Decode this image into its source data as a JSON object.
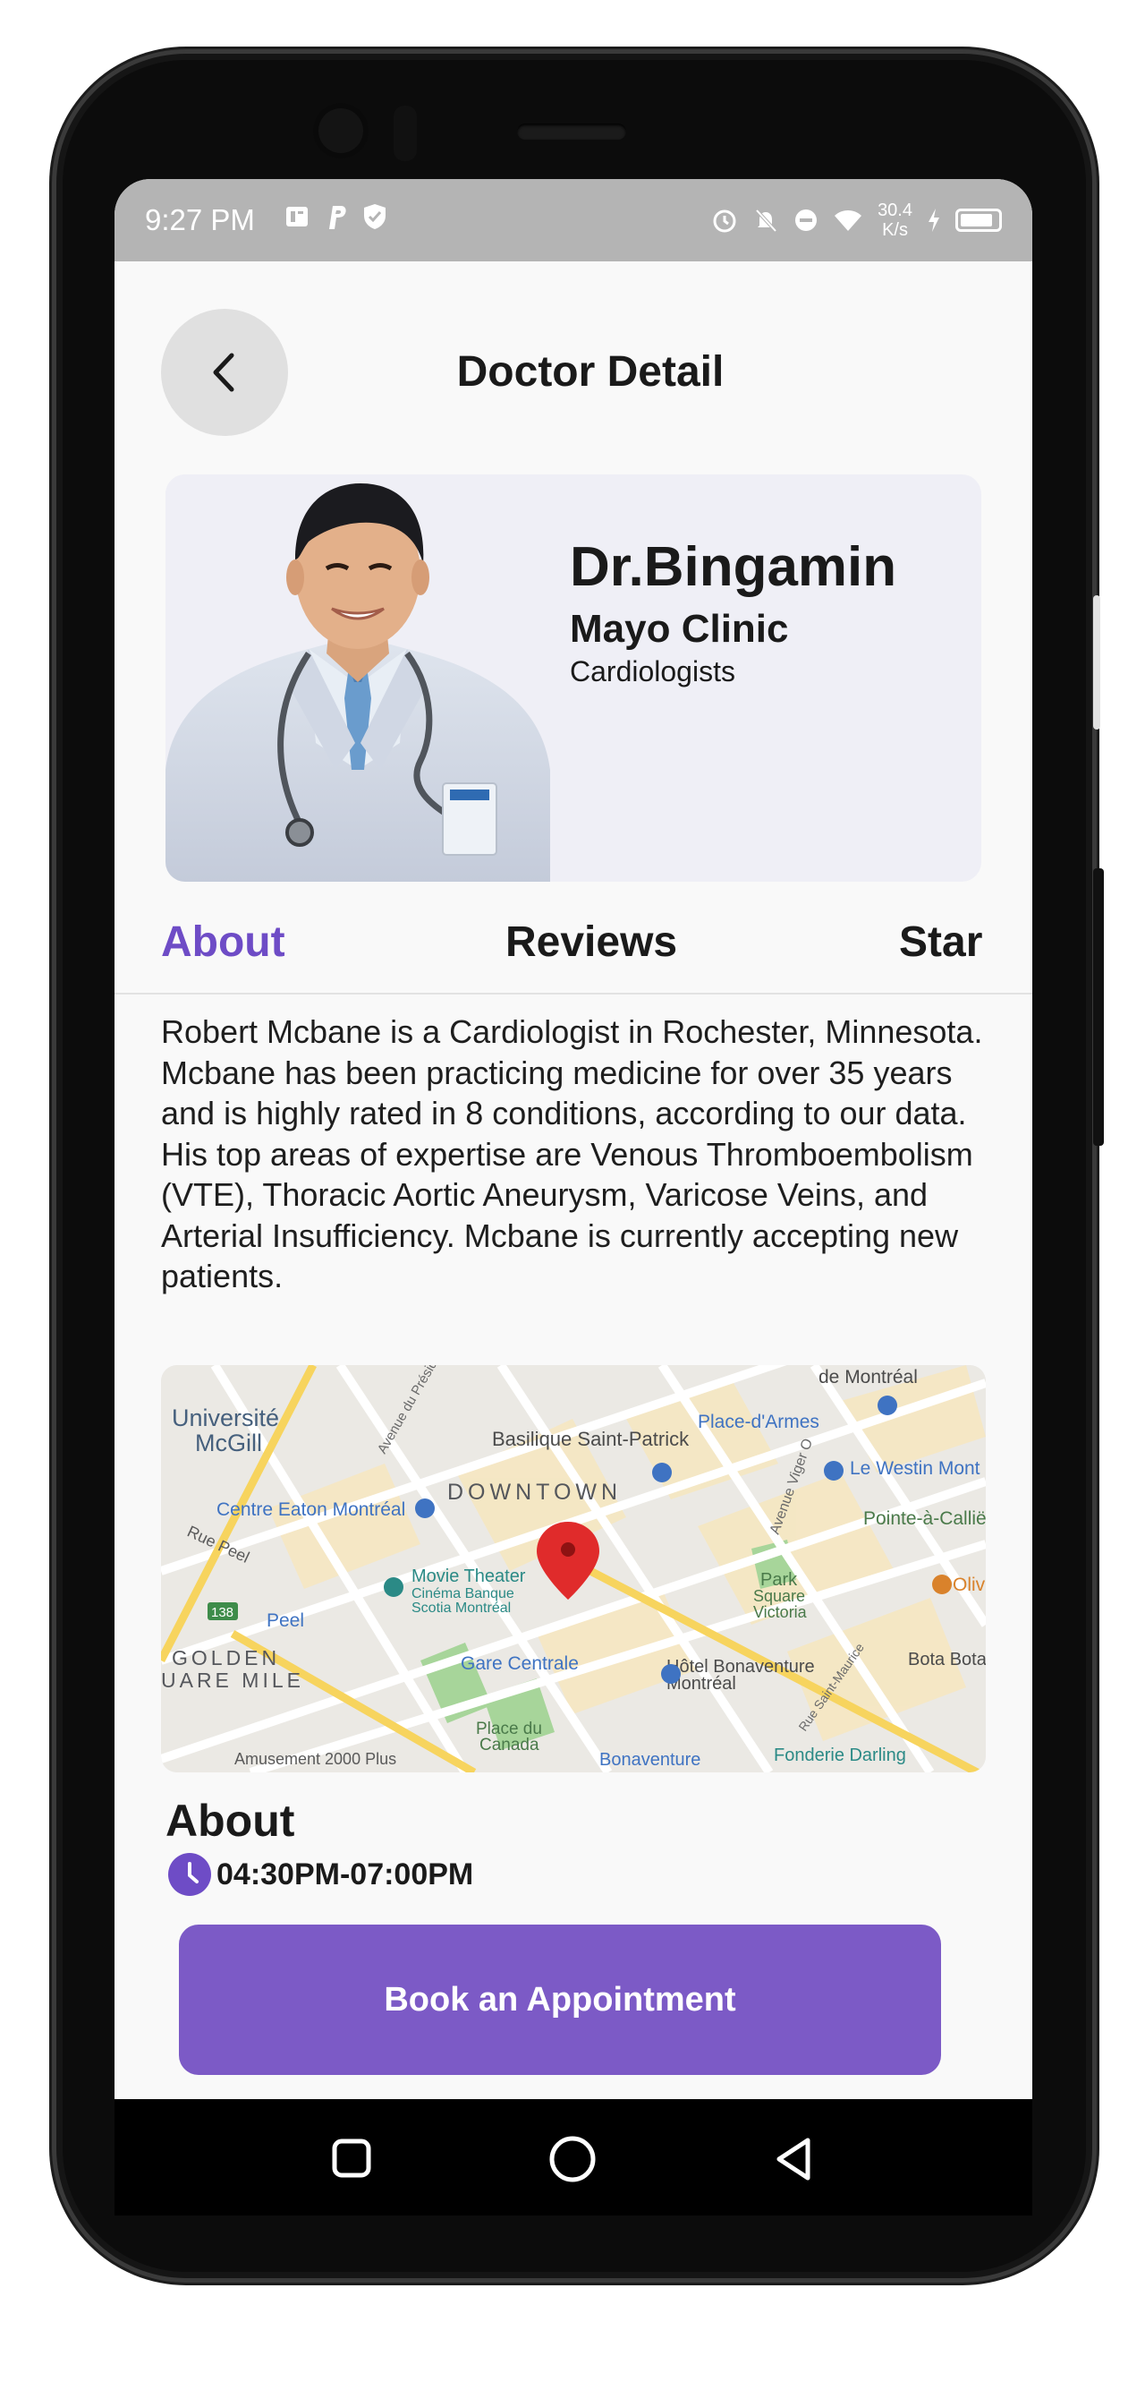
{
  "status_bar": {
    "time": "9:27 PM",
    "network_speed_value": "30.4",
    "network_speed_unit": "K/s"
  },
  "header": {
    "title": "Doctor Detail"
  },
  "doctor": {
    "name": "Dr.Bingamin",
    "clinic": "Mayo Clinic",
    "specialty": "Cardiologists"
  },
  "tabs": [
    {
      "label": "About",
      "active": true
    },
    {
      "label": "Reviews",
      "active": false
    },
    {
      "label": "Star",
      "active": false
    }
  ],
  "about": {
    "description": "Robert Mcbane is a Cardiologist in Rochester, Minnesota. Mcbane has been practicing medicine for over 35 years and is highly rated in 8 conditions, according to our data. His top areas of expertise are Venous Thromboembolism (VTE), Thoracic Aortic Aneurysm, Varicose Veins, and Arterial Insufficiency. Mcbane is currently accepting new patients."
  },
  "map": {
    "labels": {
      "universite": "Université",
      "mcgill": "McGill",
      "basilique": "Basilique Saint-Patrick",
      "place_darmes": "Place-d'Armes",
      "de_montreal": "de Montréal",
      "downtown": "DOWNTOWN",
      "eaton": "Centre Eaton Montréal",
      "westin": "Le Westin Mont",
      "pointe": "Pointe-à-Callië",
      "rue_peel": "Rue Peel",
      "movie1": "Movie Theater",
      "movie2": "Cinéma Banque",
      "movie3": "Scotia Montréal",
      "peel": "Peel",
      "park1": "Park",
      "park2": "Square",
      "park3": "Victoria",
      "golden": "GOLDEN",
      "square_mile": "UARE MILE",
      "gare": "Gare Centrale",
      "hotel1": "Hôtel Bonaventure",
      "hotel2": "Montréal",
      "bota": "Bota Bota",
      "place1": "Place du",
      "place2": "Canada",
      "amusement": "Amusement 2000 Plus",
      "bonaventure": "Bonaventure",
      "fonderie": "Fonderie Darling",
      "rue_saint": "Rue Saint-Maurice",
      "avenue_viger": "Avenue Viger O",
      "avenue_president": "Avenue du Préside",
      "olive": "Oliv",
      "route": "138"
    }
  },
  "schedule": {
    "title": "About",
    "hours": "04:30PM-07:00PM"
  },
  "actions": {
    "book_label": "Book an Appointment"
  },
  "colors": {
    "accent": "#6e4cc6",
    "button": "#7c5ac6",
    "status_bar": "#b4b4b4",
    "card_bg": "#efeff6"
  }
}
